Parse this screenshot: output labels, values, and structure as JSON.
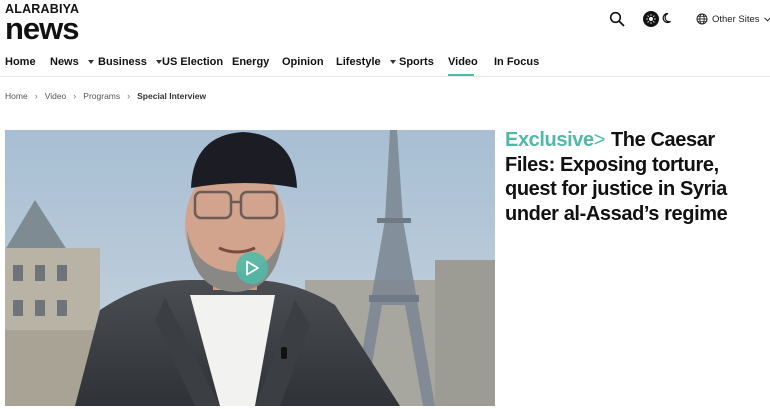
{
  "brand": {
    "logo_small": "ALARABIYA",
    "logo_big": "news"
  },
  "header": {
    "search_icon": "search-icon",
    "theme_icons": [
      "sun-icon",
      "moon-icon"
    ],
    "other_sites_label": "Other Sites",
    "other_sites_icon": "globe-icon"
  },
  "nav": {
    "items": [
      {
        "label": "Home",
        "dropdown": false
      },
      {
        "label": "News",
        "dropdown": true
      },
      {
        "label": "Business",
        "dropdown": true
      },
      {
        "label": "US Election",
        "dropdown": false
      },
      {
        "label": "Energy",
        "dropdown": false
      },
      {
        "label": "Opinion",
        "dropdown": false
      },
      {
        "label": "Lifestyle",
        "dropdown": true
      },
      {
        "label": "Sports",
        "dropdown": false
      },
      {
        "label": "Video",
        "dropdown": false,
        "active": true
      },
      {
        "label": "In Focus",
        "dropdown": false
      }
    ]
  },
  "breadcrumb": {
    "items": [
      "Home",
      "Video",
      "Programs"
    ],
    "current": "Special Interview"
  },
  "video": {
    "play_icon": "play-icon"
  },
  "article": {
    "tag": "Exclusive",
    "tag_chevron": ">",
    "title": "The Caesar Files: Exposing torture, quest for justice in Syria under al-Assad’s regime"
  },
  "colors": {
    "accent": "#4fb9a8",
    "text": "#111111"
  }
}
